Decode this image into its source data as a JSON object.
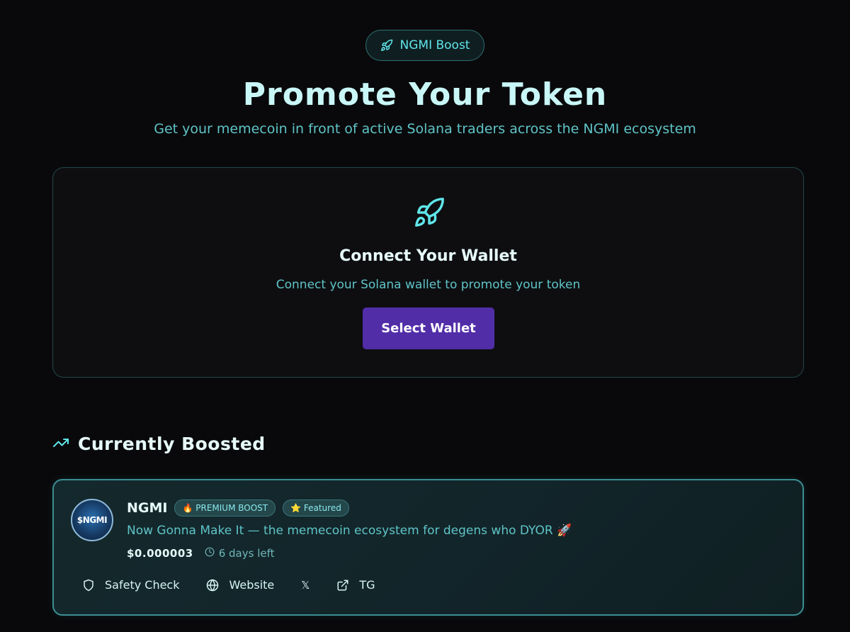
{
  "header": {
    "badge_label": "NGMI Boost",
    "badge_icon": "rocket-icon",
    "title": "Promote Your Token",
    "subtitle": "Get your memecoin in front of active Solana traders across the NGMI ecosystem"
  },
  "connect": {
    "icon": "rocket-icon",
    "title": "Connect Your Wallet",
    "description": "Connect your Solana wallet to promote your token",
    "button_label": "Select Wallet"
  },
  "boosted_section": {
    "icon": "trending-up-icon",
    "title": "Currently Boosted",
    "items": [
      {
        "avatar_text": "$NGMI",
        "name": "NGMI",
        "badges": [
          {
            "label": "🔥 PREMIUM BOOST"
          },
          {
            "label": "⭐ Featured"
          }
        ],
        "description": "Now Gonna Make It — the memecoin ecosystem for degens who DYOR 🚀",
        "price": "$0.000003",
        "time_left": "6 days left",
        "links": [
          {
            "label": "Safety Check",
            "icon": "shield-icon"
          },
          {
            "label": "Website",
            "icon": "globe-icon"
          },
          {
            "label": "",
            "icon": "x-logo-icon",
            "glyph": "𝕏"
          },
          {
            "label": "TG",
            "icon": "external-link-icon"
          }
        ]
      }
    ]
  },
  "colors": {
    "background": "#09090b",
    "accent": "#5fe6ea",
    "button": "#512da8"
  }
}
